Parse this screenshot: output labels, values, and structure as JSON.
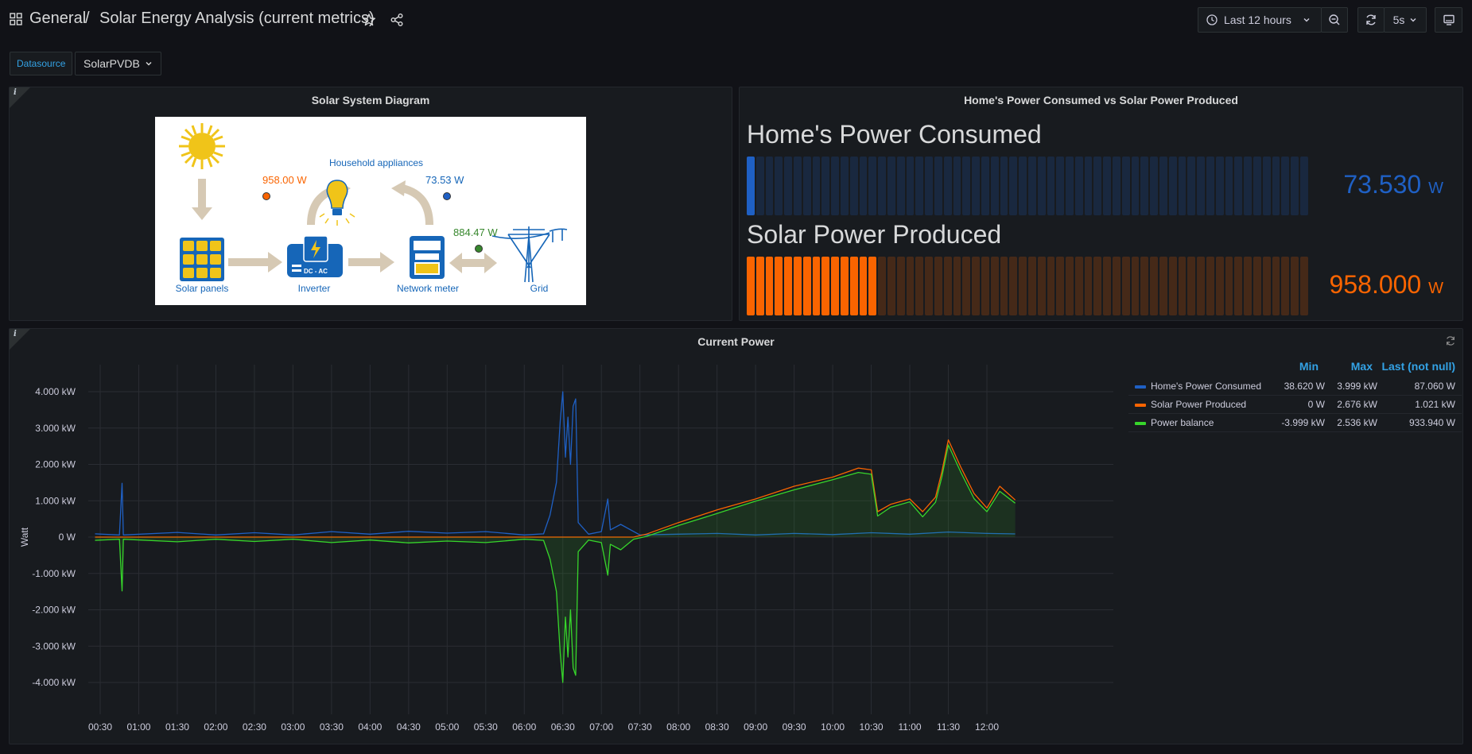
{
  "breadcrumb": {
    "folder": "General",
    "separator": "/",
    "dashboard": "Solar Energy Analysis (current metrics)"
  },
  "toolbar": {
    "time_range": "Last 12 hours",
    "refresh_interval": "5s"
  },
  "variables": {
    "label": "Datasource",
    "value": "SolarPVDB"
  },
  "diagram_panel": {
    "title": "Solar System Diagram",
    "info": "i",
    "labels": {
      "appliances": "Household appliances",
      "panels": "Solar panels",
      "inverter": "Inverter",
      "meter": "Network meter",
      "grid": "Grid",
      "inverter_badge": "DC - AC"
    },
    "values": {
      "solar": "958.00 W",
      "home": "73.53 W",
      "grid": "884.47 W"
    }
  },
  "gauge_panel": {
    "title": "Home's Power Consumed vs Solar Power Produced",
    "gauges": [
      {
        "name": "Home's Power Consumed",
        "value": "73.530",
        "unit": "W",
        "fraction": 0.018,
        "color": "#1f60c4"
      },
      {
        "name": "Solar Power Produced",
        "value": "958.000",
        "unit": "W",
        "fraction": 0.24,
        "color": "#fa6400"
      }
    ]
  },
  "graph_panel": {
    "title": "Current Power",
    "info": "i",
    "legend": {
      "headers": {
        "min": "Min",
        "max": "Max",
        "last": "Last (not null)"
      },
      "rows": [
        {
          "name": "Home's Power Consumed",
          "min": "38.620 W",
          "max": "3.999 kW",
          "last": "87.060 W",
          "color": "#1f60c4"
        },
        {
          "name": "Solar Power Produced",
          "min": "0 W",
          "max": "2.676 kW",
          "last": "1.021 kW",
          "color": "#fa6400"
        },
        {
          "name": "Power balance",
          "min": "-3.999 kW",
          "max": "2.536 kW",
          "last": "933.940 W",
          "color": "#37d62b"
        }
      ]
    }
  },
  "chart_data": {
    "type": "line",
    "ylabel": "Watt",
    "ylim": [
      -4000,
      4000
    ],
    "yticks": [
      "4.000 kW",
      "3.000 kW",
      "2.000 kW",
      "1.000 kW",
      "0 W",
      "-1.000 kW",
      "-2.000 kW",
      "-3.000 kW",
      "-4.000 kW"
    ],
    "ytick_values": [
      4000,
      3000,
      2000,
      1000,
      0,
      -1000,
      -2000,
      -3000,
      -4000
    ],
    "xticks": [
      "00:30",
      "01:00",
      "01:30",
      "02:00",
      "02:30",
      "03:00",
      "03:30",
      "04:00",
      "04:30",
      "05:00",
      "05:30",
      "06:00",
      "06:30",
      "07:00",
      "07:30",
      "08:00",
      "08:30",
      "09:00",
      "09:30",
      "10:00",
      "10:30",
      "11:00",
      "11:30",
      "12:00"
    ],
    "grid": true,
    "series": [
      {
        "name": "Home's Power Consumed",
        "color": "#1f60c4",
        "points": [
          [
            "00:26",
            90
          ],
          [
            "00:45",
            60
          ],
          [
            "00:47",
            1480
          ],
          [
            "00:48",
            60
          ],
          [
            "01:30",
            130
          ],
          [
            "02:00",
            60
          ],
          [
            "02:30",
            120
          ],
          [
            "03:00",
            60
          ],
          [
            "03:30",
            150
          ],
          [
            "04:00",
            80
          ],
          [
            "04:30",
            160
          ],
          [
            "05:00",
            110
          ],
          [
            "05:30",
            150
          ],
          [
            "06:00",
            60
          ],
          [
            "06:15",
            90
          ],
          [
            "06:20",
            600
          ],
          [
            "06:25",
            1500
          ],
          [
            "06:28",
            3200
          ],
          [
            "06:30",
            4000
          ],
          [
            "06:32",
            2200
          ],
          [
            "06:34",
            3300
          ],
          [
            "06:36",
            2000
          ],
          [
            "06:38",
            3600
          ],
          [
            "06:40",
            3800
          ],
          [
            "06:42",
            400
          ],
          [
            "06:50",
            80
          ],
          [
            "07:00",
            150
          ],
          [
            "07:05",
            1050
          ],
          [
            "07:07",
            200
          ],
          [
            "07:15",
            350
          ],
          [
            "07:30",
            60
          ],
          [
            "08:00",
            80
          ],
          [
            "08:30",
            100
          ],
          [
            "09:00",
            60
          ],
          [
            "09:30",
            100
          ],
          [
            "10:00",
            70
          ],
          [
            "10:30",
            120
          ],
          [
            "11:00",
            80
          ],
          [
            "11:30",
            140
          ],
          [
            "12:00",
            100
          ],
          [
            "12:22",
            87
          ]
        ]
      },
      {
        "name": "Solar Power Produced",
        "color": "#fa6400",
        "points": [
          [
            "00:26",
            0
          ],
          [
            "07:25",
            0
          ],
          [
            "07:35",
            80
          ],
          [
            "08:00",
            400
          ],
          [
            "08:30",
            750
          ],
          [
            "09:00",
            1050
          ],
          [
            "09:30",
            1400
          ],
          [
            "10:00",
            1650
          ],
          [
            "10:20",
            1900
          ],
          [
            "10:30",
            1850
          ],
          [
            "10:35",
            700
          ],
          [
            "10:45",
            900
          ],
          [
            "11:00",
            1050
          ],
          [
            "11:10",
            700
          ],
          [
            "11:20",
            1100
          ],
          [
            "11:25",
            1800
          ],
          [
            "11:30",
            2676
          ],
          [
            "11:40",
            1900
          ],
          [
            "11:50",
            1200
          ],
          [
            "12:00",
            800
          ],
          [
            "12:10",
            1400
          ],
          [
            "12:22",
            1021
          ]
        ]
      },
      {
        "name": "Power balance",
        "color": "#37d62b",
        "points": [
          [
            "00:26",
            -90
          ],
          [
            "00:45",
            -60
          ],
          [
            "00:47",
            -1480
          ],
          [
            "00:48",
            -60
          ],
          [
            "01:30",
            -130
          ],
          [
            "02:00",
            -60
          ],
          [
            "02:30",
            -120
          ],
          [
            "03:00",
            -60
          ],
          [
            "03:30",
            -150
          ],
          [
            "04:00",
            -80
          ],
          [
            "04:30",
            -160
          ],
          [
            "05:00",
            -110
          ],
          [
            "05:30",
            -150
          ],
          [
            "06:00",
            -60
          ],
          [
            "06:15",
            -90
          ],
          [
            "06:20",
            -600
          ],
          [
            "06:25",
            -1500
          ],
          [
            "06:28",
            -3200
          ],
          [
            "06:30",
            -3999
          ],
          [
            "06:32",
            -2200
          ],
          [
            "06:34",
            -3300
          ],
          [
            "06:36",
            -2000
          ],
          [
            "06:38",
            -3600
          ],
          [
            "06:40",
            -3800
          ],
          [
            "06:42",
            -400
          ],
          [
            "06:50",
            -80
          ],
          [
            "07:00",
            -150
          ],
          [
            "07:05",
            -1050
          ],
          [
            "07:07",
            -200
          ],
          [
            "07:15",
            -350
          ],
          [
            "07:25",
            -60
          ],
          [
            "07:35",
            20
          ],
          [
            "08:00",
            320
          ],
          [
            "08:30",
            650
          ],
          [
            "09:00",
            990
          ],
          [
            "09:30",
            1300
          ],
          [
            "10:00",
            1580
          ],
          [
            "10:20",
            1780
          ],
          [
            "10:30",
            1730
          ],
          [
            "10:35",
            580
          ],
          [
            "10:45",
            820
          ],
          [
            "11:00",
            970
          ],
          [
            "11:10",
            560
          ],
          [
            "11:20",
            960
          ],
          [
            "11:25",
            1660
          ],
          [
            "11:30",
            2536
          ],
          [
            "11:40",
            1760
          ],
          [
            "11:50",
            1060
          ],
          [
            "12:00",
            700
          ],
          [
            "12:10",
            1260
          ],
          [
            "12:22",
            934
          ]
        ]
      }
    ]
  }
}
